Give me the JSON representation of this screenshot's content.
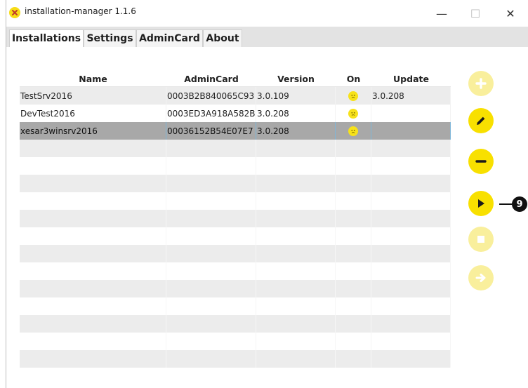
{
  "window": {
    "title": "installation-manager 1.1.6",
    "icon": "x-logo-icon",
    "controls": {
      "minimize": "—",
      "maximize": "☐",
      "close": "✕"
    }
  },
  "tabs": [
    {
      "label": "Installations",
      "active": true
    },
    {
      "label": "Settings",
      "active": false
    },
    {
      "label": "AdminCard",
      "active": false
    },
    {
      "label": "About",
      "active": false
    }
  ],
  "table": {
    "columns": [
      "Name",
      "AdminCard",
      "Version",
      "On",
      "Update"
    ],
    "rows": [
      {
        "name": "TestSrv2016",
        "admincard": "0003B2B840065C93",
        "version": "3.0.109",
        "on": "sad-face-icon",
        "update": "3.0.208"
      },
      {
        "name": "DevTest2016",
        "admincard": "0003ED3A918A582B",
        "version": "3.0.208",
        "on": "sad-face-icon",
        "update": ""
      },
      {
        "name": "xesar3winsrv2016",
        "admincard": "00036152B54E07E7",
        "version": "3.0.208",
        "on": "sad-face-icon",
        "update": "",
        "selected": true
      }
    ]
  },
  "actions": [
    {
      "name": "add",
      "icon": "plus-icon",
      "enabled": false
    },
    {
      "name": "edit",
      "icon": "pencil-icon",
      "enabled": true
    },
    {
      "name": "remove",
      "icon": "minus-icon",
      "enabled": true
    },
    {
      "name": "start",
      "icon": "play-icon",
      "enabled": true
    },
    {
      "name": "stop",
      "icon": "stop-icon",
      "enabled": false
    },
    {
      "name": "update",
      "icon": "arrow-right-icon",
      "enabled": false
    }
  ],
  "callout": {
    "number": "9"
  },
  "colors": {
    "accent": "#f8e000",
    "accent_disabled": "#f9ef9c",
    "selection": "#a8a8a8"
  }
}
